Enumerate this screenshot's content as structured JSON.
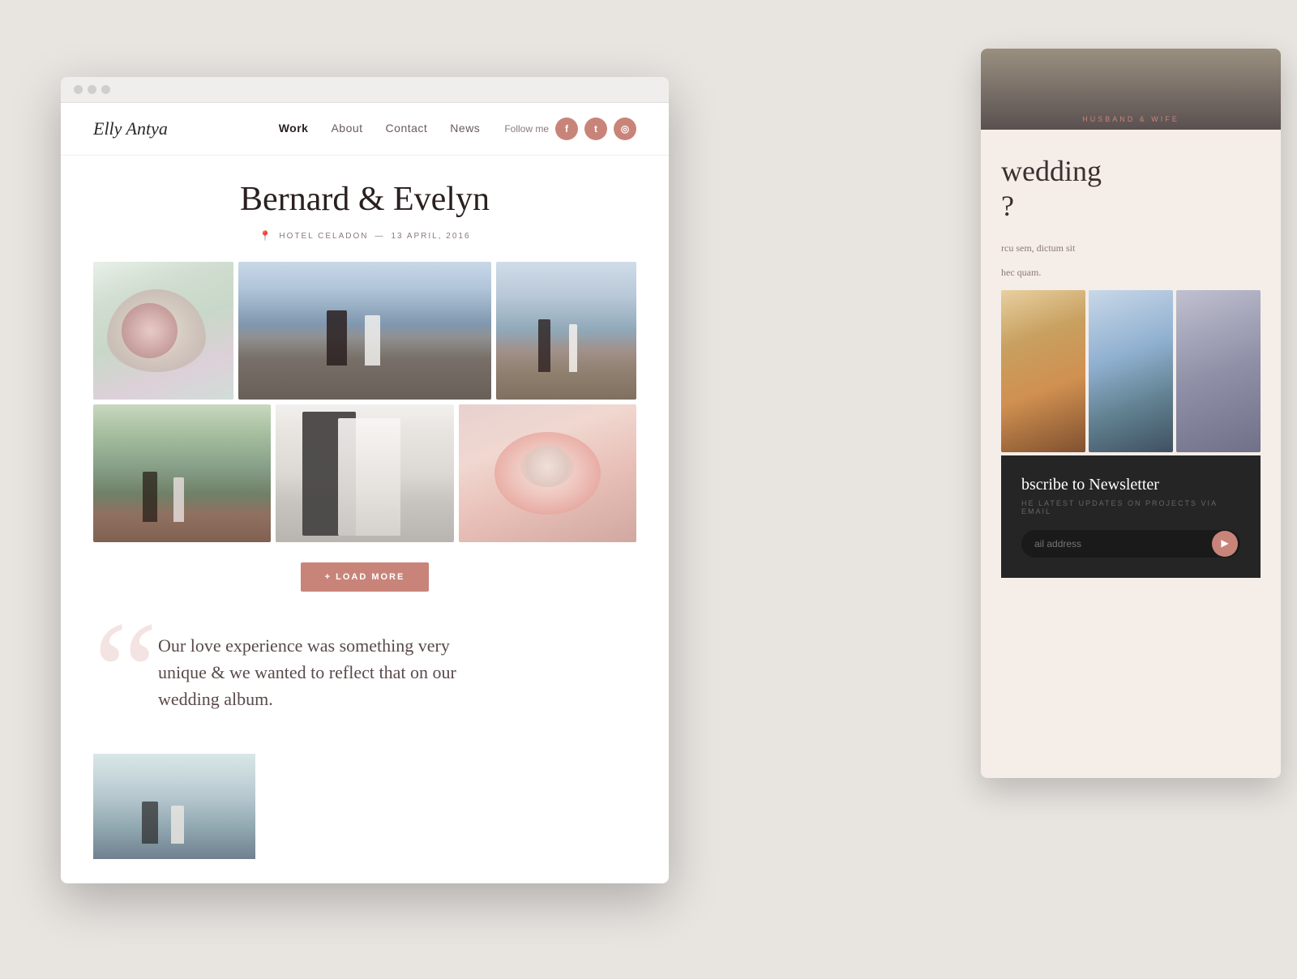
{
  "background": {
    "color": "#e8e4e0"
  },
  "second_browser": {
    "husband_wife_label": "HUSBAND & WIFE",
    "heading_line1": "wedding",
    "heading_line2": "?",
    "para1": "rcu sem, dictum sit",
    "para2": "hec quam.",
    "newsletter": {
      "title": "bscribe to Newsletter",
      "subtitle": "HE LATEST UPDATES ON PROJECTS VIA EMAIL",
      "input_placeholder": "ail address",
      "send_icon": "▶"
    }
  },
  "main_browser": {
    "titlebar": {
      "dots": [
        "dot1",
        "dot2",
        "dot3"
      ]
    },
    "nav": {
      "logo": "Elly Antya",
      "links": [
        {
          "label": "Work",
          "active": true
        },
        {
          "label": "About",
          "active": false
        },
        {
          "label": "Contact",
          "active": false
        },
        {
          "label": "News",
          "active": false
        }
      ],
      "follow_label": "Follow me",
      "social": [
        {
          "icon": "f",
          "name": "facebook"
        },
        {
          "icon": "t",
          "name": "twitter"
        },
        {
          "icon": "◎",
          "name": "instagram"
        }
      ]
    },
    "page": {
      "title": "Bernard & Evelyn",
      "location": "HOTEL CELADON",
      "date": "13 APRIL, 2016",
      "load_more_label": "+ LOAD MORE",
      "quote_mark": "“",
      "quote_text": "Our love experience was something very unique & we wanted to reflect that on our wedding album."
    }
  }
}
